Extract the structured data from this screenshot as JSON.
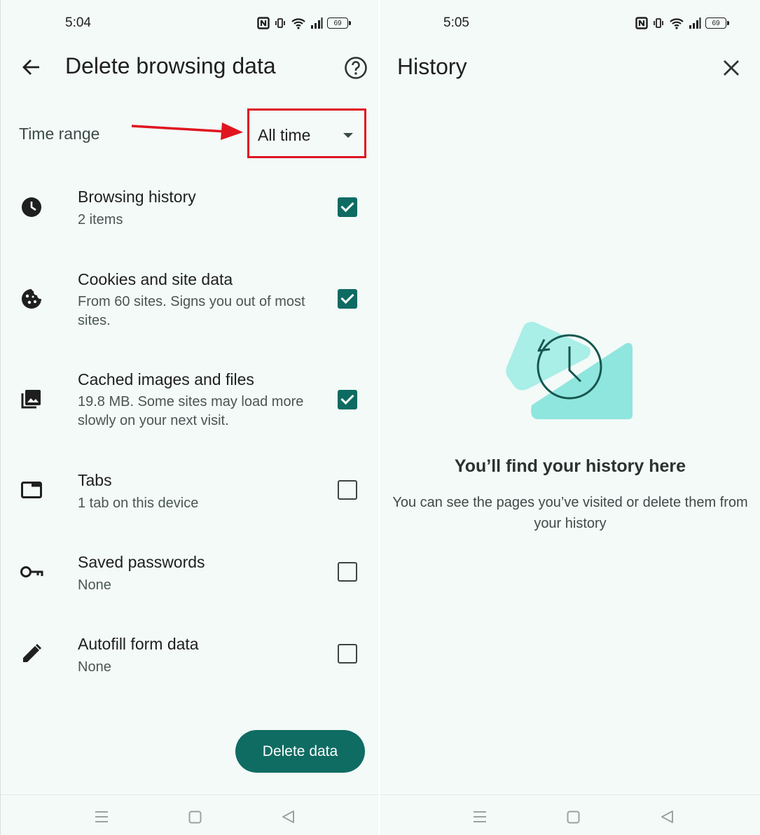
{
  "left": {
    "status": {
      "time": "5:04",
      "battery": "69"
    },
    "title": "Delete browsing data",
    "time_range": {
      "label": "Time range",
      "value": "All time"
    },
    "options": [
      {
        "title": "Browsing history",
        "subtitle": "2 items",
        "checked": true,
        "icon": "clock-icon"
      },
      {
        "title": "Cookies and site data",
        "subtitle": "From 60 sites. Signs you out of most sites.",
        "checked": true,
        "icon": "cookie-icon"
      },
      {
        "title": "Cached images and files",
        "subtitle": "19.8 MB. Some sites may load more slowly on your next visit.",
        "checked": true,
        "icon": "image-icon"
      },
      {
        "title": "Tabs",
        "subtitle": "1 tab on this device",
        "checked": false,
        "icon": "tab-icon"
      },
      {
        "title": "Saved passwords",
        "subtitle": "None",
        "checked": false,
        "icon": "key-icon"
      },
      {
        "title": "Autofill form data",
        "subtitle": "None",
        "checked": false,
        "icon": "pencil-icon"
      }
    ],
    "delete_button": "Delete data"
  },
  "right": {
    "status": {
      "time": "5:05",
      "battery": "69"
    },
    "title": "History",
    "empty_title": "You’ll find your history here",
    "empty_subtitle": "You can see the pages you’ve visited or delete them from your history"
  },
  "colors": {
    "background": "#f3faf8",
    "accent": "#0f6c63",
    "annotation": "#e0151f",
    "illustration": "#8fe6de"
  }
}
